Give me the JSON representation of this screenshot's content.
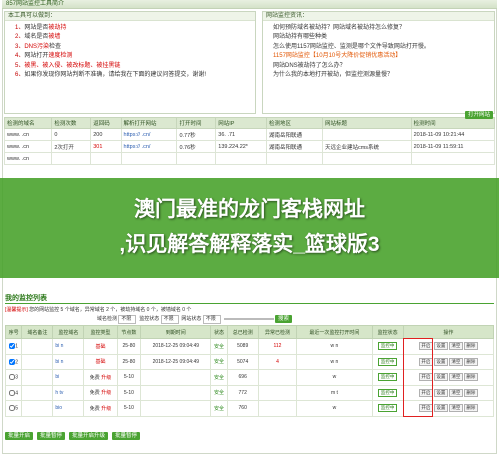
{
  "title": "857网站监控工具简介",
  "intro": {
    "header": "本工具可以做到：",
    "items": [
      {
        "num": "1、",
        "text": "网站是否",
        "hl": "被劫持",
        "hl_class": "red"
      },
      {
        "num": "2、",
        "text": "域名是否",
        "hl": "被墙",
        "hl_class": "red"
      },
      {
        "num": "3、",
        "text": "",
        "hl": "DNS污染",
        "hl_class": "red",
        "tail": "检查"
      },
      {
        "num": "4、",
        "text": "网站打开",
        "hl": "速度检测",
        "hl_class": "red"
      },
      {
        "num": "5、",
        "text": "",
        "hl": "被黑、被入侵、被改标题、被挂黑链",
        "hl_class": "red"
      },
      {
        "num": "6、",
        "text": "如果你发现你网站判断不准确，请给我在下面的建议问答提交，谢谢!",
        "hl": "",
        "hl_class": ""
      }
    ]
  },
  "info": {
    "header": "网站监控资讯：",
    "items": [
      {
        "text": "如何预防域名被劫持？网站域名被劫持怎么修复？",
        "cls": ""
      },
      {
        "text": "网站劫持有哪些种类",
        "cls": ""
      },
      {
        "text": "怎么使用1157网站监控、监测是哪个文件导致网站打开慢。",
        "cls": ""
      },
      {
        "text": "1157网站监控【10月10号大降价促销优惠活动】",
        "cls": "orange"
      },
      {
        "text": "网站DNS被劫持了怎么办？",
        "cls": ""
      },
      {
        "text": "为什么我的本地打开被劫，但监控测源量慢？",
        "cls": ""
      }
    ]
  },
  "test_table": {
    "open_btn": "打开网站",
    "headers": [
      "检测的域名",
      "检测次数",
      "返回码",
      "解析打开网站",
      "打开时间",
      "网站IP",
      "检测地区",
      "网站标题",
      "检测时间"
    ],
    "rows": [
      [
        "www.        .cn",
        "0",
        "200",
        "https://         .cn/",
        "0.77秒",
        "36.     .71",
        "湖南岳阳联通",
        "",
        "2018-11-09 10:21:44"
      ],
      [
        "www.        .cn",
        "2次打开",
        "301",
        "https://         .cn/",
        "0.76秒",
        "139.224.22*",
        "湖南岳阳联通",
        "天远企业建站cms系统",
        "2018-11-09 11:59:11"
      ],
      [
        "www.        .cn",
        "",
        "",
        "",
        "",
        "",
        "",
        "",
        ""
      ]
    ]
  },
  "overlay": {
    "line1": "澳门最准的龙门客栈网址",
    "line2": ",识见解答解释落实_篮球版3"
  },
  "monitor": {
    "title": "我的监控列表",
    "notice_label": "[温馨提示]",
    "notice": "您的网站监控 5 个域名，异常域名 2 个，被劫持域名 0 个，被墙域名 0 个",
    "filters": {
      "f1_label": "域名检测",
      "f1_val": "不限",
      "f2_label": "监控状态",
      "f2_val": "不限",
      "f3_label": "网站状态",
      "f3_val": "不限",
      "search_btn": "搜索"
    },
    "headers": [
      "序号",
      "域名备注",
      "监控域名",
      "监控类型",
      "节点数",
      "到期时间",
      "状态",
      "总已检测",
      "异常已检测",
      "最近一次监控打开时间",
      "监控状态",
      "操作"
    ],
    "rows": [
      {
        "no": "1",
        "checked": true,
        "domain": "bi          n",
        "type": "基础",
        "nodes": "25-80",
        "expire": "2018-12-25 09:04:49",
        "status": "安全",
        "total": "5089",
        "abn": "112",
        "last": "w            n",
        "mon": "监控中"
      },
      {
        "no": "2",
        "checked": true,
        "domain": "bi          n",
        "type": "基础",
        "nodes": "25-80",
        "expire": "2018-12-25 09:04:49",
        "status": "安全",
        "total": "5074",
        "abn": "4",
        "last": "w            n",
        "mon": "监控中"
      },
      {
        "no": "3",
        "checked": false,
        "domain": "bi          ",
        "type": "免费",
        "nodes": "5-10",
        "expire": "",
        "status": "安全",
        "total": "696",
        "abn": "",
        "last": "w            ",
        "mon": "监控中"
      },
      {
        "no": "4",
        "checked": false,
        "domain": "h           tv",
        "type": "免费",
        "nodes": "5-10",
        "expire": "",
        "status": "安全",
        "total": "772",
        "abn": "",
        "last": "m            t",
        "mon": "监控中"
      },
      {
        "no": "5",
        "checked": false,
        "domain": "bio          ",
        "type": "免费",
        "nodes": "5-10",
        "expire": "",
        "status": "安全",
        "total": "760",
        "abn": "",
        "last": "w            ",
        "mon": "监控中"
      }
    ],
    "upgrade_label": "升级",
    "ops": [
      "开启",
      "设置",
      "清空",
      "删除"
    ],
    "bulk_btns": [
      "批量开启",
      "批量暂停",
      "批量开启升级",
      "批量暂停"
    ]
  }
}
